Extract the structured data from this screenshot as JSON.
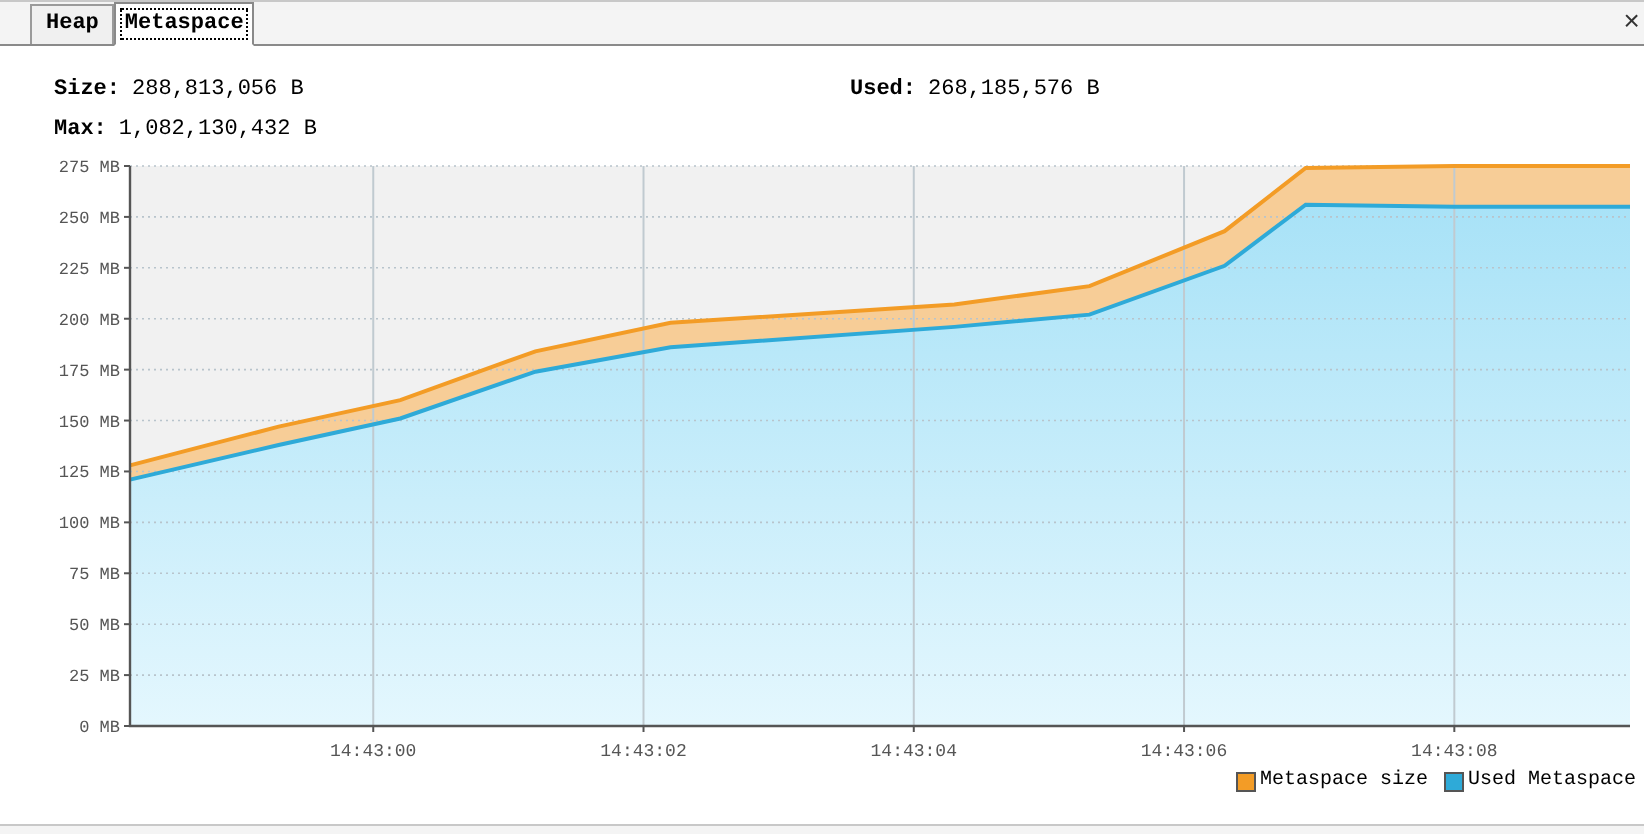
{
  "tabs": [
    {
      "label": "Heap",
      "selected": false
    },
    {
      "label": "Metaspace",
      "selected": true
    }
  ],
  "close_button": "×",
  "stats": [
    {
      "label": "Size:",
      "value": "288,813,056 B"
    },
    {
      "label": "Used:",
      "value": "268,185,576 B"
    },
    {
      "label": "Max:",
      "value": "1,082,130,432 B"
    }
  ],
  "chart": {
    "chart_data": {
      "type": "area",
      "x": [
        52978.2,
        52979.3,
        52980.2,
        52981.2,
        52982.2,
        52984.3,
        52985.3,
        52986.3,
        52986.9,
        52988,
        52989.3
      ],
      "series": [
        {
          "name": "Metaspace size",
          "color": "#f39c26",
          "values": [
            128,
            147,
            160,
            184,
            198,
            207,
            216,
            243,
            274,
            275,
            275
          ]
        },
        {
          "name": "Used Metaspace",
          "color": "#2eaad8",
          "values": [
            121,
            138,
            151,
            174,
            186,
            196,
            202,
            226,
            256,
            255,
            255
          ]
        }
      ],
      "xlim": [
        52978.2,
        52989.3
      ],
      "ylim": [
        0,
        275
      ],
      "grid": true,
      "xticks": [
        {
          "value": 52980,
          "label": "14:43:00"
        },
        {
          "value": 52982,
          "label": "14:43:02"
        },
        {
          "value": 52984,
          "label": "14:43:04"
        },
        {
          "value": 52986,
          "label": "14:43:06"
        },
        {
          "value": 52988,
          "label": "14:43:08"
        }
      ],
      "yticks": [
        {
          "value": 0,
          "label": "0 MB"
        },
        {
          "value": 25,
          "label": "25 MB"
        },
        {
          "value": 50,
          "label": "50 MB"
        },
        {
          "value": 75,
          "label": "75 MB"
        },
        {
          "value": 100,
          "label": "100 MB"
        },
        {
          "value": 125,
          "label": "125 MB"
        },
        {
          "value": 150,
          "label": "150 MB"
        },
        {
          "value": 175,
          "label": "175 MB"
        },
        {
          "value": 200,
          "label": "200 MB"
        },
        {
          "value": 225,
          "label": "225 MB"
        },
        {
          "value": 250,
          "label": "250 MB"
        },
        {
          "value": 275,
          "label": "275 MB"
        }
      ]
    }
  }
}
